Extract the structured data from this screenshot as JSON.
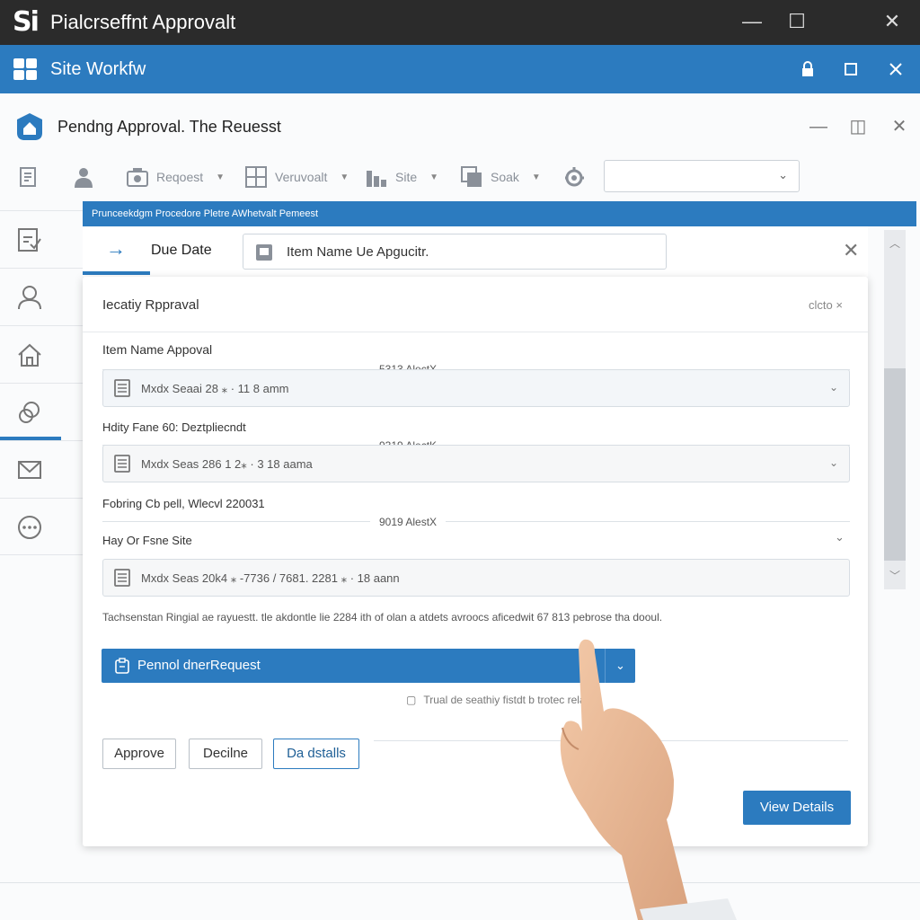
{
  "window": {
    "logo": "Si",
    "title": "Pialcrseffnt Approvalt",
    "controls": [
      "—",
      "☐",
      "✕"
    ]
  },
  "sitebar": {
    "title": "Site Workfw",
    "controls": [
      "🔒",
      "☐",
      "✕"
    ]
  },
  "header": {
    "title": "Pendng Approval. The Reuesst",
    "controls": [
      "—",
      "◫",
      "✕"
    ]
  },
  "toolbar": {
    "items": [
      {
        "label": "",
        "icon": "document-list-icon"
      },
      {
        "label": "",
        "icon": "user-icon"
      },
      {
        "label": "Reqoest",
        "icon": "camera-icon"
      },
      {
        "label": "Veruvoalt",
        "icon": "grid-icon"
      },
      {
        "label": "Site",
        "icon": "bar-chart-icon"
      },
      {
        "label": "Soak",
        "icon": "copy-icon"
      },
      {
        "label": "",
        "icon": "settings-icon"
      }
    ],
    "select_value": ""
  },
  "panel": {
    "strip_text": "Prunceekdgm Procedore Pletre AWhetvalt Pemeest",
    "tab_label": "Due Date",
    "item_search_value": "Item Name Ue Apgucitr."
  },
  "card": {
    "title": "Iecatiy Rppraval",
    "close_label": "clcto ×",
    "sections": [
      {
        "label": "Item Name Appoval",
        "divider": "5313 AlectX",
        "field_value": "Mxdx Seaai 28 ⁎ · 11 8 amm"
      },
      {
        "label": "Hdity Fane 60: Deztpliecndt",
        "divider": "9319 AlectK",
        "field_value": "Mxdx Seas 286 1 2⁎ · 3 18 aama"
      },
      {
        "label": "Fobring Cb pell, Wlecvl 220031",
        "divider": "9019 AlestX",
        "field_value": ""
      },
      {
        "label": "Hay Or Fsne Site",
        "divider": "",
        "field_value": "Mxdx Seas 20k4 ⁎ -7736 / 7681. 2281 ⁎ · 18 aann"
      }
    ],
    "footnote": "Tachsenstan Ringial ae rayuestt. tle akdontle lie 2284 ith of olan a atdets avroocs aficedwit 67 813 pebrose tha dooul.",
    "primary_button": "Pennol dnerRequest",
    "hint": "Trual de seathiy fistdt b trotec relaiod",
    "buttons": {
      "approve": "Approve",
      "decline": "Decilne",
      "details": "Da dstalls"
    },
    "view_details": "View Details"
  },
  "colors": {
    "accent": "#2c7bbf",
    "titlebar": "#2b2b2b"
  }
}
